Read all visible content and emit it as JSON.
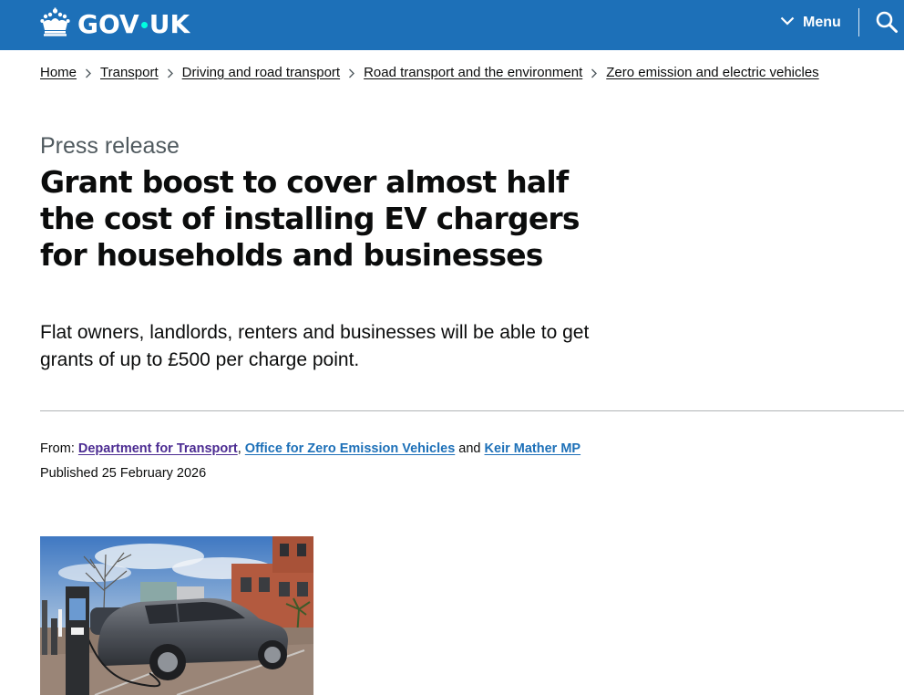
{
  "header": {
    "logo_text_left": "GOV",
    "logo_text_right": "UK",
    "menu_label": "Menu",
    "brand_color": "#1d70b8",
    "icons": [
      "crown-icon",
      "chevron-down-icon",
      "search-icon"
    ]
  },
  "breadcrumbs": [
    {
      "label": "Home"
    },
    {
      "label": "Transport"
    },
    {
      "label": "Driving and road transport"
    },
    {
      "label": "Road transport and the environment"
    },
    {
      "label": "Zero emission and electric vehicles"
    }
  ],
  "article": {
    "caption": "Press release",
    "title": "Grant boost to cover almost half the cost of installing EV chargers for households and businesses",
    "lead": "Flat owners, landlords, renters and businesses will be able to get grants of up to £500 per charge point."
  },
  "metadata": {
    "from_label": "From:",
    "organisations": [
      {
        "label": "Department for Transport",
        "color": "#4c2c92"
      },
      {
        "label": "Office for Zero Emission Vehicles",
        "color": "#1d70b8"
      },
      {
        "label": "Keir Mather MP",
        "color": "#1d70b8"
      }
    ],
    "separator_comma": ",",
    "separator_and": "and",
    "published_label": "Published",
    "published_date": "25 February 2026"
  },
  "image": {
    "subject": "car-charging-photo"
  }
}
